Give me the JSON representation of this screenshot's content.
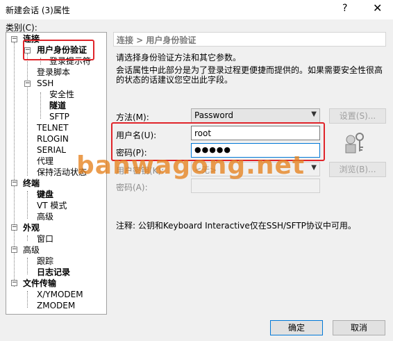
{
  "window": {
    "title": "新建会话 (3)属性",
    "help": "?",
    "close": "✕"
  },
  "category_label": "类别(C):",
  "tree": [
    {
      "label": "连接",
      "bold": true
    },
    {
      "label": "用户身份验证",
      "bold": true
    },
    {
      "label": "登录提示符",
      "bold": false
    },
    {
      "label": "登录脚本",
      "bold": false
    },
    {
      "label": "SSH",
      "bold": false
    },
    {
      "label": "安全性",
      "bold": false
    },
    {
      "label": "隧道",
      "bold": true
    },
    {
      "label": "SFTP",
      "bold": false
    },
    {
      "label": "TELNET",
      "bold": false
    },
    {
      "label": "RLOGIN",
      "bold": false
    },
    {
      "label": "SERIAL",
      "bold": false
    },
    {
      "label": "代理",
      "bold": false
    },
    {
      "label": "保持活动状态",
      "bold": false
    },
    {
      "label": "终端",
      "bold": true
    },
    {
      "label": "键盘",
      "bold": true
    },
    {
      "label": "VT 模式",
      "bold": false
    },
    {
      "label": "高级",
      "bold": false
    },
    {
      "label": "外观",
      "bold": true
    },
    {
      "label": "窗口",
      "bold": false
    },
    {
      "label": "高级",
      "bold": false
    },
    {
      "label": "跟踪",
      "bold": false
    },
    {
      "label": "日志记录",
      "bold": true
    },
    {
      "label": "文件传输",
      "bold": true
    },
    {
      "label": "X/YMODEM",
      "bold": false
    },
    {
      "label": "ZMODEM",
      "bold": false
    }
  ],
  "panel": {
    "breadcrumb": "连接 > 用户身份验证",
    "desc1": "请选择身份验证方法和其它参数。",
    "desc2": "会话属性中此部分是为了登录过程更便捷而提供的。如果需要安全性很高",
    "desc3": "的状态的话建议您空出此字段。",
    "method_label": "方法(M):",
    "method_value": "Password",
    "settings_button": "设置(S)...",
    "username_label": "用户名(U):",
    "username_value": "root",
    "password_label": "密码(P):",
    "password_value": "●●●●●",
    "user_key_label": "用户密钥(K):",
    "user_key_value": "<无>",
    "browse_button": "浏览(B)...",
    "passphrase_label": "密码(A):",
    "note": "注释: 公钥和Keyboard Interactive仅在SSH/SFTP协议中可用。"
  },
  "buttons": {
    "ok": "确定",
    "cancel": "取消"
  },
  "watermark": "banwagong.net",
  "colors": {
    "highlight_box": "#e0242a",
    "focus": "#0078d7",
    "watermark": "#e6821e"
  }
}
